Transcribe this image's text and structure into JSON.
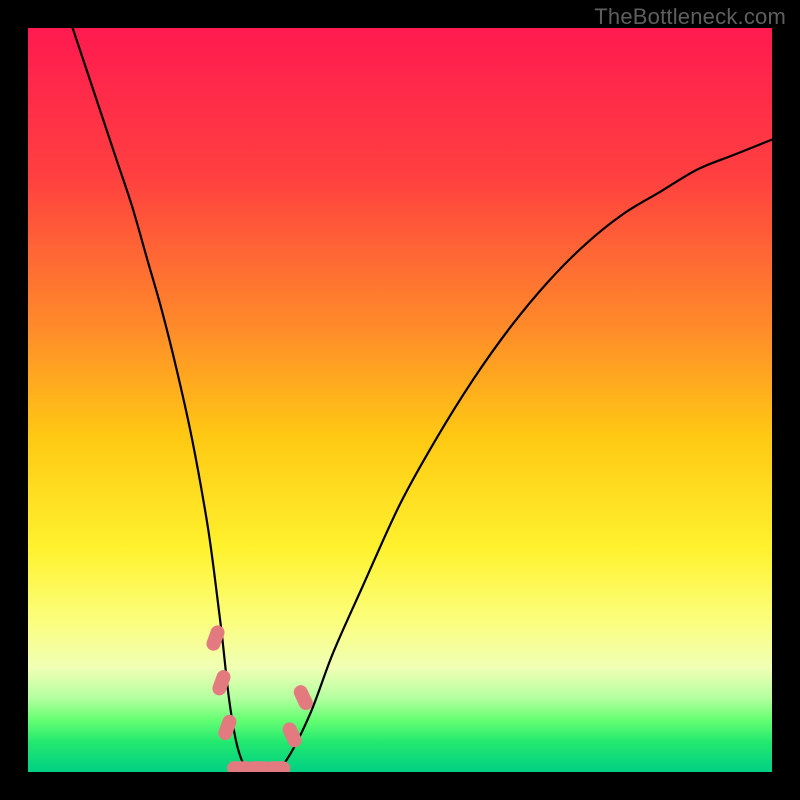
{
  "watermark": "TheBottleneck.com",
  "chart_data": {
    "type": "line",
    "title": "",
    "xlabel": "",
    "ylabel": "",
    "xlim": [
      0,
      100
    ],
    "ylim": [
      0,
      100
    ],
    "grid": false,
    "legend": false,
    "gradient_stops": [
      {
        "offset": 0,
        "color": "#ff1a50"
      },
      {
        "offset": 20,
        "color": "#ff4040"
      },
      {
        "offset": 40,
        "color": "#ff8a2a"
      },
      {
        "offset": 55,
        "color": "#ffc913"
      },
      {
        "offset": 70,
        "color": "#fff22e"
      },
      {
        "offset": 80,
        "color": "#fbff80"
      },
      {
        "offset": 86,
        "color": "#f0ffb5"
      },
      {
        "offset": 90,
        "color": "#b5ffa0"
      },
      {
        "offset": 93,
        "color": "#66ff73"
      },
      {
        "offset": 96,
        "color": "#23e86f"
      },
      {
        "offset": 100,
        "color": "#00d084"
      }
    ],
    "series": [
      {
        "name": "curve",
        "color": "#000000",
        "x": [
          6,
          8,
          10,
          12,
          14,
          16,
          18,
          20,
          22,
          24,
          25,
          26,
          27,
          28,
          29,
          30,
          31,
          33,
          35,
          38,
          41,
          45,
          50,
          55,
          60,
          65,
          70,
          75,
          80,
          85,
          90,
          95,
          100
        ],
        "y": [
          100,
          94,
          88,
          82,
          76,
          69,
          62,
          54,
          45,
          34,
          27,
          19,
          10,
          4,
          1,
          0,
          0,
          0,
          2,
          8,
          16,
          25,
          36,
          45,
          53,
          60,
          66,
          71,
          75,
          78,
          81,
          83,
          85
        ]
      }
    ],
    "flat_segment": {
      "x_start": 28,
      "x_end": 34,
      "y": 0
    },
    "markers": {
      "color": "#e37a7f",
      "items": [
        {
          "x": 25.2,
          "y": 18
        },
        {
          "x": 26.0,
          "y": 12
        },
        {
          "x": 26.8,
          "y": 6
        },
        {
          "x": 28.5,
          "y": 0.5
        },
        {
          "x": 31.0,
          "y": 0.5
        },
        {
          "x": 33.5,
          "y": 0.5
        },
        {
          "x": 35.5,
          "y": 5
        },
        {
          "x": 37.0,
          "y": 10
        }
      ]
    }
  }
}
